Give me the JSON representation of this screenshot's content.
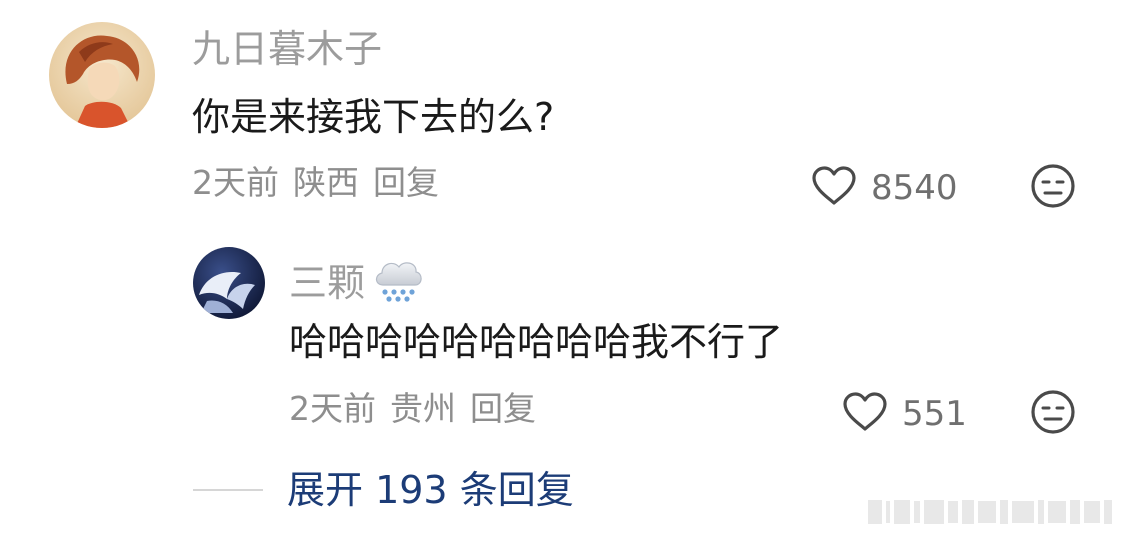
{
  "comment": {
    "username": "九日暮木子",
    "text": "你是来接我下去的么?",
    "time": "2天前",
    "location": "陕西",
    "reply_label": "回复",
    "likes": "8540",
    "avatar_icon": "avatar-illustration-icon"
  },
  "reply": {
    "username": "三颗",
    "username_emoji_icon": "snow-cloud-icon",
    "text": "哈哈哈哈哈哈哈哈哈我不行了",
    "time": "2天前",
    "location": "贵州",
    "reply_label": "回复",
    "likes": "551",
    "avatar_icon": "avatar-dark-illustration-icon"
  },
  "expand": {
    "label": "展开 193 条回复"
  },
  "icons": {
    "like": "heart-outline-icon",
    "dislike": "neutral-face-icon"
  },
  "colors": {
    "username": "#9c9c9c",
    "content": "#1a1a1a",
    "meta": "#8e8e8e",
    "link": "#1c3c77"
  }
}
